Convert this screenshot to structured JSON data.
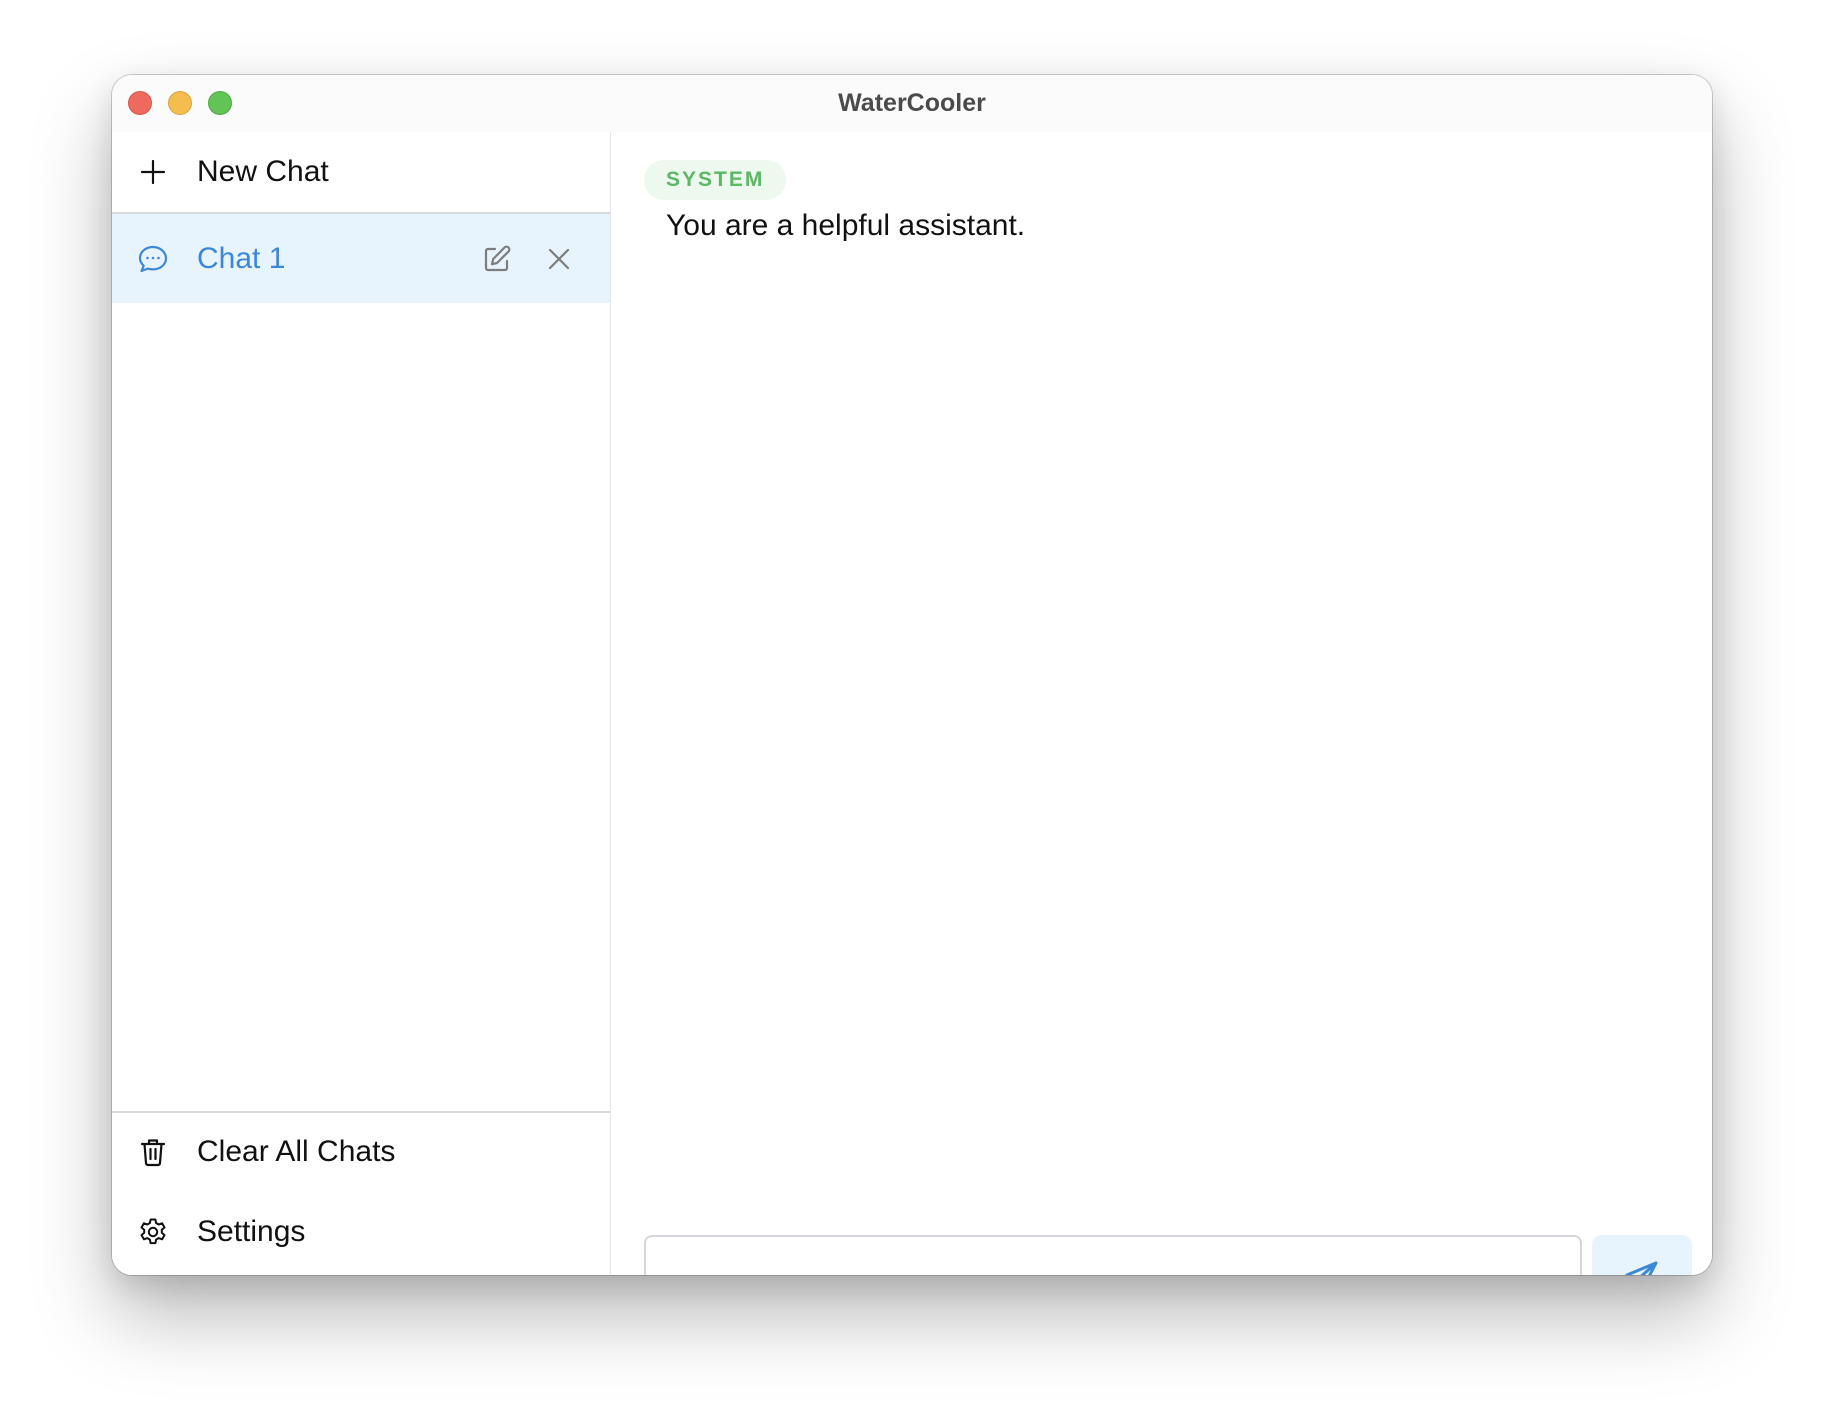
{
  "window": {
    "title": "WaterCooler",
    "controls": [
      "close",
      "minimize",
      "zoom"
    ]
  },
  "sidebar": {
    "new_chat": {
      "label": "New Chat",
      "icon": "plus-icon"
    },
    "chats": [
      {
        "label": "Chat 1",
        "icon": "chat-bubble-icon",
        "selected": true,
        "actions": [
          "edit-icon",
          "close-icon"
        ]
      }
    ],
    "footer": [
      {
        "label": "Clear All Chats",
        "icon": "trash-icon"
      },
      {
        "label": "Settings",
        "icon": "gear-icon"
      }
    ]
  },
  "conversation": {
    "messages": [
      {
        "role_badge": "SYSTEM",
        "text": "You are a helpful assistant."
      }
    ]
  },
  "composer": {
    "value": "",
    "placeholder": "",
    "send_icon": "send-icon"
  },
  "colors": {
    "accent": "#3b87d9",
    "selected_bg": "#e7f3fd",
    "system_badge_text": "#5cb865",
    "system_badge_bg": "#edf8ee"
  }
}
